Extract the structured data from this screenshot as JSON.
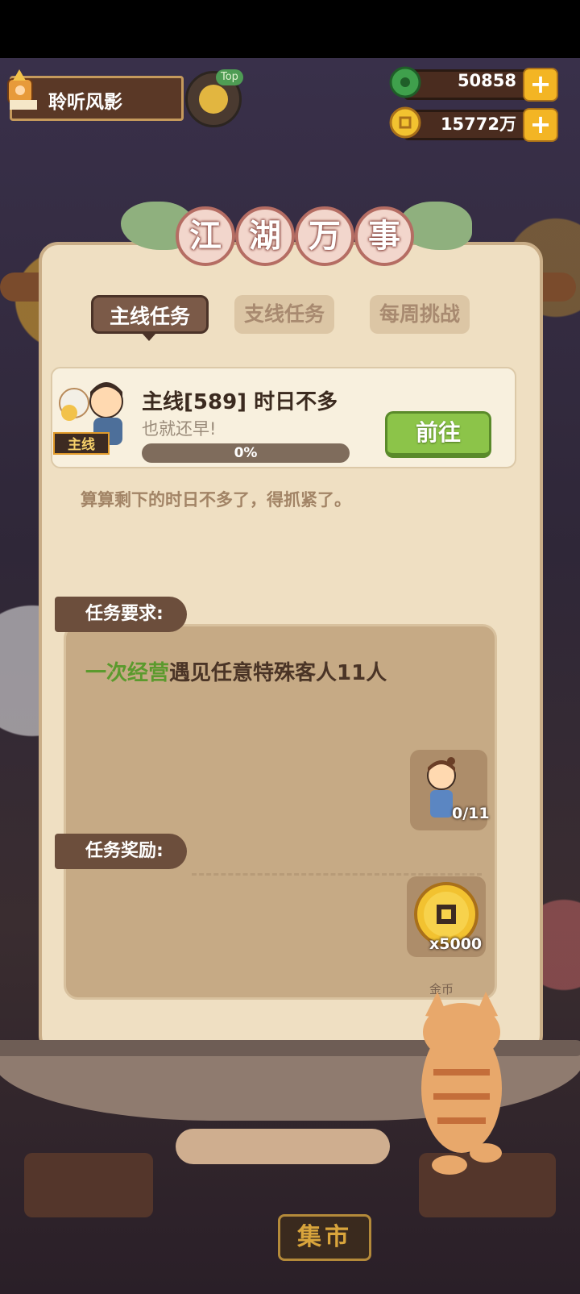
{
  "player": {
    "name": "聆听风影"
  },
  "top_button": {
    "tag": "Top"
  },
  "currencies": [
    {
      "name": "jade",
      "value": "50858",
      "icon": "jade-icon"
    },
    {
      "name": "gold",
      "value": "15772万",
      "icon": "gold-coin-icon"
    }
  ],
  "panel": {
    "title_chars": [
      "江",
      "湖",
      "万",
      "事"
    ],
    "tabs": [
      {
        "label": "主线任务",
        "active": true
      },
      {
        "label": "支线任务",
        "active": false
      },
      {
        "label": "每周挑战",
        "active": false
      }
    ],
    "quest": {
      "tag": "主线",
      "title": "主线[589] 时日不多",
      "subtitle": "也就还早!",
      "progress_percent": 0,
      "progress_text": "0%",
      "go_label": "前往"
    },
    "description": "算算剩下的时日不多了，得抓紧了。",
    "requirement": {
      "label": "任务要求:",
      "highlight": "一次经营",
      "text": "遇见任意特殊客人11人",
      "target_count": "0/11"
    },
    "reward": {
      "label": "任务奖励:",
      "amount": "x5000",
      "item_name": "金币"
    }
  },
  "market": {
    "label": "集市"
  },
  "colors": {
    "accent_green": "#5b9a2d",
    "button_green": "#8cc449",
    "panel_bg": "#efdfc2"
  }
}
